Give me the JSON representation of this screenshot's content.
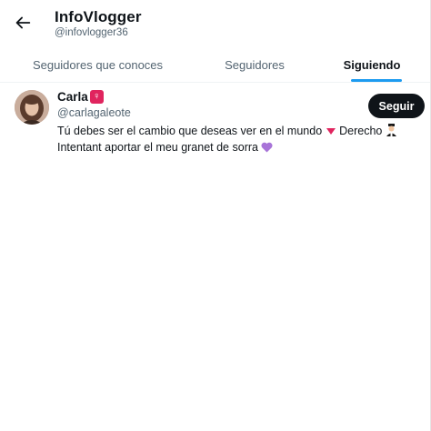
{
  "header": {
    "title": "InfoVlogger",
    "handle": "@infovlogger36",
    "back_icon": "arrow-left-icon"
  },
  "tabs": [
    {
      "label": "Seguidores que conoces",
      "active": false
    },
    {
      "label": "Seguidores",
      "active": false
    },
    {
      "label": "Siguiendo",
      "active": true
    }
  ],
  "colors": {
    "accent": "#1d9bf0",
    "text_primary": "#0f1419",
    "text_secondary": "#536471",
    "follow_button_bg": "#0f1419",
    "female_badge": "#e0245e"
  },
  "users": [
    {
      "name": "Carla",
      "badge_icon": "female-sign-icon",
      "handle": "@carlagaleote",
      "follow_label": "Seguir",
      "bio_line1": "Tú debes ser el cambio que deseas ver en el mundo",
      "bio_line1_b": "Derecho",
      "bio_line2": "Intentant aportar el meu granet de sorra",
      "bio_icons": [
        "red-triangle-down-icon",
        "judge-icon",
        "purple-heart-icon"
      ]
    }
  ]
}
